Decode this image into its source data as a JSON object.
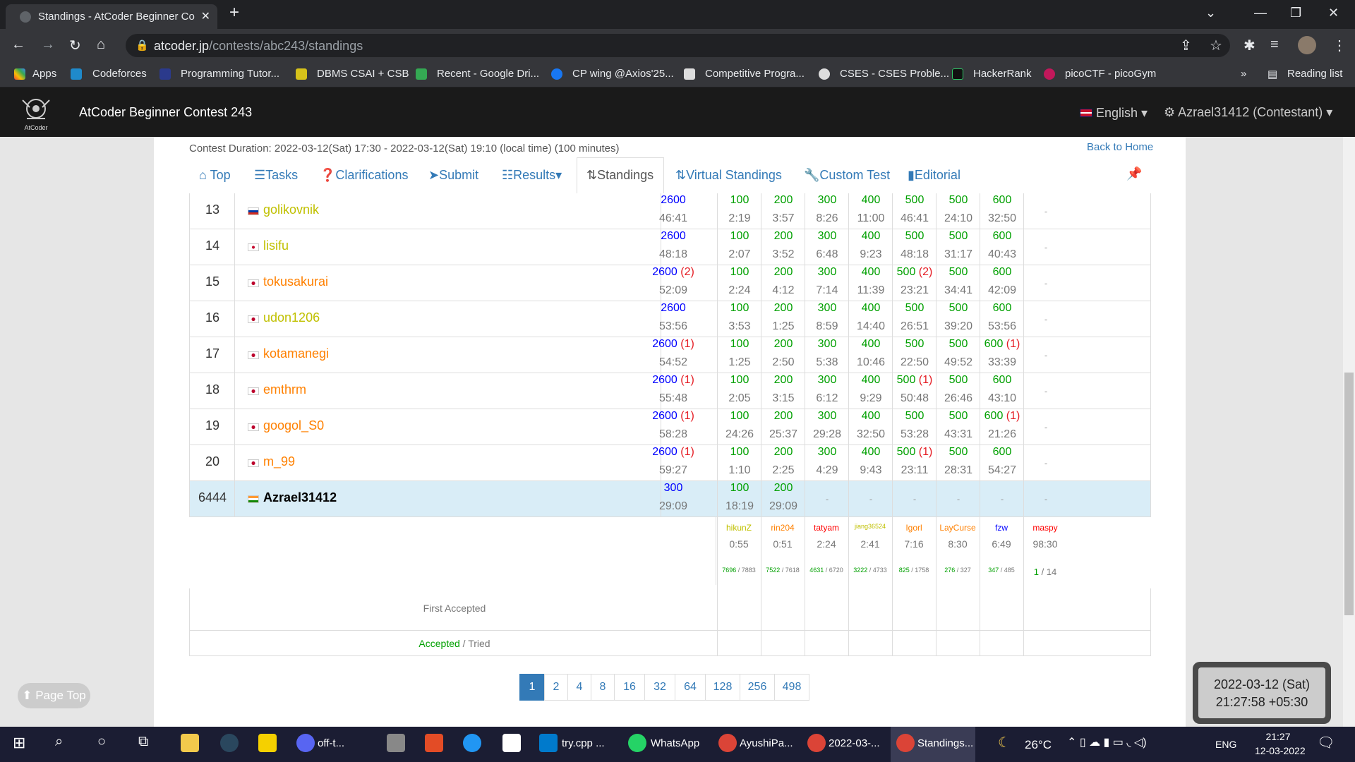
{
  "browser": {
    "tab_title": "Standings - AtCoder Beginner Co",
    "url_host": "atcoder.jp",
    "url_path": "/contests/abc243/standings",
    "bookmarks": [
      "Apps",
      "Codeforces",
      "Programming Tutor...",
      "DBMS CSAI + CSB",
      "Recent - Google Dri...",
      "CP wing @Axios'25...",
      "Competitive Progra...",
      "CSES - CSES Proble...",
      "HackerRank",
      "picoCTF - picoGym"
    ],
    "reading_list": "Reading list",
    "more": "»"
  },
  "header": {
    "logo_text": "AtCoder",
    "contest_name": "AtCoder Beginner Contest 243",
    "language": "English",
    "user": "Azrael31412 (Contestant)"
  },
  "contest": {
    "duration": "Contest Duration: 2022-03-12(Sat) 17:30 - 2022-03-12(Sat) 19:10 (local time) (100 minutes)",
    "back_home": "Back to Home"
  },
  "tabs": [
    "Top",
    "Tasks",
    "Clarifications",
    "Submit",
    "Results",
    "Standings",
    "Virtual Standings",
    "Custom Test",
    "Editorial"
  ],
  "rows": [
    {
      "rank": "13",
      "flag": "ru",
      "user": "golikovnik",
      "color": "#c0c000",
      "total": "2600",
      "total_pen": "",
      "total_time": "46:41",
      "scores": [
        "100",
        "200",
        "300",
        "400",
        "500",
        "500",
        "600"
      ],
      "pens": [
        "",
        "",
        "",
        "",
        "",
        "",
        ""
      ],
      "times": [
        "2:19",
        "3:57",
        "8:26",
        "11:00",
        "46:41",
        "24:10",
        "32:50"
      ],
      "extra": "-"
    },
    {
      "rank": "14",
      "flag": "kr",
      "user": "lisifu",
      "color": "#c0c000",
      "total": "2600",
      "total_pen": "",
      "total_time": "48:18",
      "scores": [
        "100",
        "200",
        "300",
        "400",
        "500",
        "500",
        "600"
      ],
      "pens": [
        "",
        "",
        "",
        "",
        "",
        "",
        ""
      ],
      "times": [
        "2:07",
        "3:52",
        "6:48",
        "9:23",
        "48:18",
        "31:17",
        "40:43"
      ],
      "extra": "-"
    },
    {
      "rank": "15",
      "flag": "jp",
      "user": "tokusakurai",
      "color": "#ff8000",
      "total": "2600",
      "total_pen": "(2)",
      "total_time": "52:09",
      "scores": [
        "100",
        "200",
        "300",
        "400",
        "500",
        "500",
        "600"
      ],
      "pens": [
        "",
        "",
        "",
        "",
        "(2)",
        "",
        ""
      ],
      "times": [
        "2:24",
        "4:12",
        "7:14",
        "11:39",
        "23:21",
        "34:41",
        "42:09"
      ],
      "extra": "-"
    },
    {
      "rank": "16",
      "flag": "jp",
      "user": "udon1206",
      "color": "#c0c000",
      "total": "2600",
      "total_pen": "",
      "total_time": "53:56",
      "scores": [
        "100",
        "200",
        "300",
        "400",
        "500",
        "500",
        "600"
      ],
      "pens": [
        "",
        "",
        "",
        "",
        "",
        "",
        ""
      ],
      "times": [
        "3:53",
        "1:25",
        "8:59",
        "14:40",
        "26:51",
        "39:20",
        "53:56"
      ],
      "extra": "-"
    },
    {
      "rank": "17",
      "flag": "jp",
      "user": "kotamanegi",
      "color": "#ff8000",
      "total": "2600",
      "total_pen": "(1)",
      "total_time": "54:52",
      "scores": [
        "100",
        "200",
        "300",
        "400",
        "500",
        "500",
        "600"
      ],
      "pens": [
        "",
        "",
        "",
        "",
        "",
        "",
        "(1)"
      ],
      "times": [
        "1:25",
        "2:50",
        "5:38",
        "10:46",
        "22:50",
        "49:52",
        "33:39"
      ],
      "extra": "-"
    },
    {
      "rank": "18",
      "flag": "jp",
      "user": "emthrm",
      "color": "#ff8000",
      "total": "2600",
      "total_pen": "(1)",
      "total_time": "55:48",
      "scores": [
        "100",
        "200",
        "300",
        "400",
        "500",
        "500",
        "600"
      ],
      "pens": [
        "",
        "",
        "",
        "",
        "(1)",
        "",
        ""
      ],
      "times": [
        "2:05",
        "3:15",
        "6:12",
        "9:29",
        "50:48",
        "26:46",
        "43:10"
      ],
      "extra": "-"
    },
    {
      "rank": "19",
      "flag": "jp",
      "user": "googol_S0",
      "color": "#ff8000",
      "total": "2600",
      "total_pen": "(1)",
      "total_time": "58:28",
      "scores": [
        "100",
        "200",
        "300",
        "400",
        "500",
        "500",
        "600"
      ],
      "pens": [
        "",
        "",
        "",
        "",
        "",
        "",
        "(1)"
      ],
      "times": [
        "24:26",
        "25:37",
        "29:28",
        "32:50",
        "53:28",
        "43:31",
        "21:26"
      ],
      "extra": "-"
    },
    {
      "rank": "20",
      "flag": "jp",
      "user": "m_99",
      "color": "#ff8000",
      "total": "2600",
      "total_pen": "(1)",
      "total_time": "59:27",
      "scores": [
        "100",
        "200",
        "300",
        "400",
        "500",
        "500",
        "600"
      ],
      "pens": [
        "",
        "",
        "",
        "",
        "(1)",
        "",
        ""
      ],
      "times": [
        "1:10",
        "2:25",
        "4:29",
        "9:43",
        "23:11",
        "28:31",
        "54:27"
      ],
      "extra": "-"
    }
  ],
  "me": {
    "rank": "6444",
    "flag": "in",
    "user": "Azrael31412",
    "total": "300",
    "total_time": "29:09",
    "scores": [
      "100",
      "200",
      "-",
      "-",
      "-",
      "-",
      "-"
    ],
    "times": [
      "18:19",
      "29:09",
      "",
      "",
      "",
      "",
      ""
    ],
    "extra": "-"
  },
  "first_accepted": {
    "label": "First Accepted",
    "users": [
      {
        "name": "hikunZ",
        "time": "0:55",
        "color": "#c0c000"
      },
      {
        "name": "rin204",
        "time": "0:51",
        "color": "#ff8000"
      },
      {
        "name": "tatyam",
        "time": "2:24",
        "color": "#ff0000"
      },
      {
        "name": "jiang36524",
        "time": "2:41",
        "color": "#c0c000"
      },
      {
        "name": "Igorl",
        "time": "7:16",
        "color": "#ff8000"
      },
      {
        "name": "LayCurse",
        "time": "8:30",
        "color": "#ff8000"
      },
      {
        "name": "fzw",
        "time": "6:49",
        "color": "#0000ff"
      },
      {
        "name": "maspy",
        "time": "98:30",
        "color": "#ff0000"
      }
    ]
  },
  "accepted_tried": {
    "label_accepted": "Accepted",
    "label_tried": "/ Tried",
    "values": [
      {
        "a": "7696",
        "t": "7883"
      },
      {
        "a": "7522",
        "t": "7618"
      },
      {
        "a": "4631",
        "t": "6720"
      },
      {
        "a": "3222",
        "t": "4733"
      },
      {
        "a": "825",
        "t": "1758"
      },
      {
        "a": "276",
        "t": "327"
      },
      {
        "a": "347",
        "t": "485"
      },
      {
        "a": "1",
        "t": "14"
      }
    ]
  },
  "pagination": [
    "1",
    "2",
    "4",
    "8",
    "16",
    "32",
    "64",
    "128",
    "256",
    "498"
  ],
  "page_top": "Page Top",
  "clock": {
    "date": "2022-03-12 (Sat)",
    "time": "21:27:58 +05:30"
  },
  "taskbar": {
    "items": [
      "off-t...",
      "try.cpp ...",
      "WhatsApp",
      "AyushiPa...",
      "2022-03-...",
      "Standings..."
    ],
    "temp": "26°C",
    "lang": "ENG",
    "time": "21:27",
    "date": "12-03-2022"
  },
  "colors": {
    "accent": "#337ab7",
    "score_green": "#00a000",
    "total_blue": "#0000ff",
    "penalty_red": "#e51c23",
    "my_row": "#d9edf7"
  }
}
